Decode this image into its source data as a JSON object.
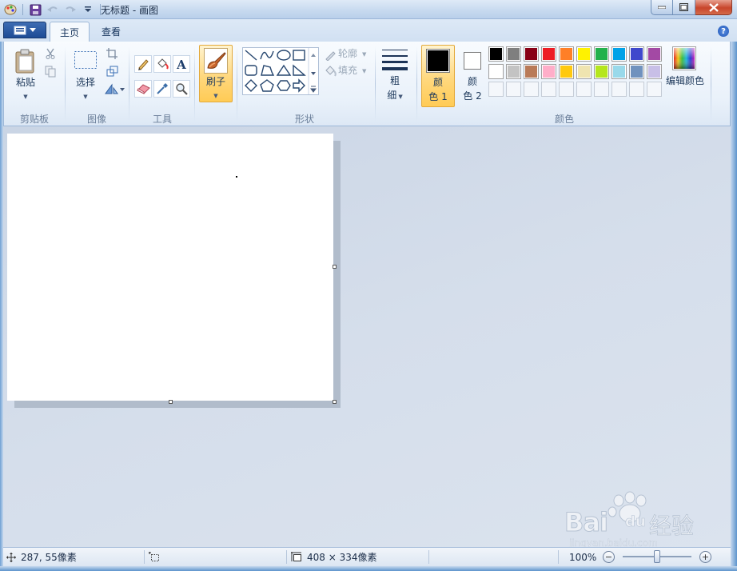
{
  "window": {
    "title": "无标题 - 画图"
  },
  "tabs": {
    "home": "主页",
    "view": "查看"
  },
  "groups": {
    "clipboard": "剪贴板",
    "image": "图像",
    "tools": "工具",
    "shapes": "形状",
    "colors": "颜色"
  },
  "clipboard": {
    "paste": "粘贴"
  },
  "image": {
    "select": "选择"
  },
  "brushes": {
    "label": "刷子"
  },
  "shapes": {
    "outline": "轮廓",
    "fill": "填充"
  },
  "size": {
    "label_line1": "粗",
    "label_line2": "细"
  },
  "colors": {
    "color1_line1": "颜",
    "color1_line2": "色 1",
    "color2_line1": "颜",
    "color2_line2": "色 2",
    "edit": "编辑颜色",
    "color1_value": "#000000",
    "color2_value": "#ffffff",
    "palette_row1": [
      "#000000",
      "#7f7f7f",
      "#880015",
      "#ed1c24",
      "#ff7f27",
      "#fff200",
      "#22b14c",
      "#00a2e8",
      "#3f48cc",
      "#a349a4"
    ],
    "palette_row2": [
      "#ffffff",
      "#c3c3c3",
      "#b97a57",
      "#ffaec9",
      "#ffc90e",
      "#efe4b0",
      "#b5e61d",
      "#99d9ea",
      "#7092be",
      "#c8bfe7"
    ],
    "palette_row3_count": 10
  },
  "status": {
    "cursor_pos": "287, 55像素",
    "canvas_size": "408 × 334像素",
    "zoom": "100%",
    "zoom_level": 1.0
  },
  "watermark": {
    "brand": "Bai",
    "brand2": "du",
    "cn": "经验",
    "url": "jingyan.baidu.com"
  }
}
